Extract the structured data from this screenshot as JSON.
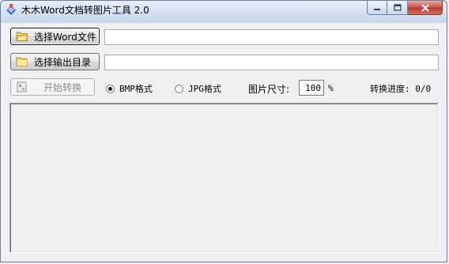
{
  "window": {
    "title": "木木Word文档转图片工具 2.0",
    "controls": {
      "minimize": "minimize",
      "maximize": "maximize",
      "close": "close"
    }
  },
  "buttons": {
    "select_word": "选择Word文件",
    "select_output": "选择输出目录",
    "start_convert": "开始转换"
  },
  "inputs": {
    "word_file_path": "",
    "output_dir_path": ""
  },
  "format": {
    "bmp_label": "BMP格式",
    "jpg_label": "JPG格式",
    "selected": "BMP格式"
  },
  "size": {
    "label": "图片尺寸:",
    "value": "100",
    "unit": "%"
  },
  "progress": {
    "text": "转换进度: 0/0"
  },
  "icons": {
    "app": "document-image-icon",
    "folder": "folder-open-icon",
    "start": "convert-icon"
  },
  "colors": {
    "titlebar": "#c9d9ee",
    "close_button": "#c75050",
    "window_bg": "#f0f0f0"
  }
}
